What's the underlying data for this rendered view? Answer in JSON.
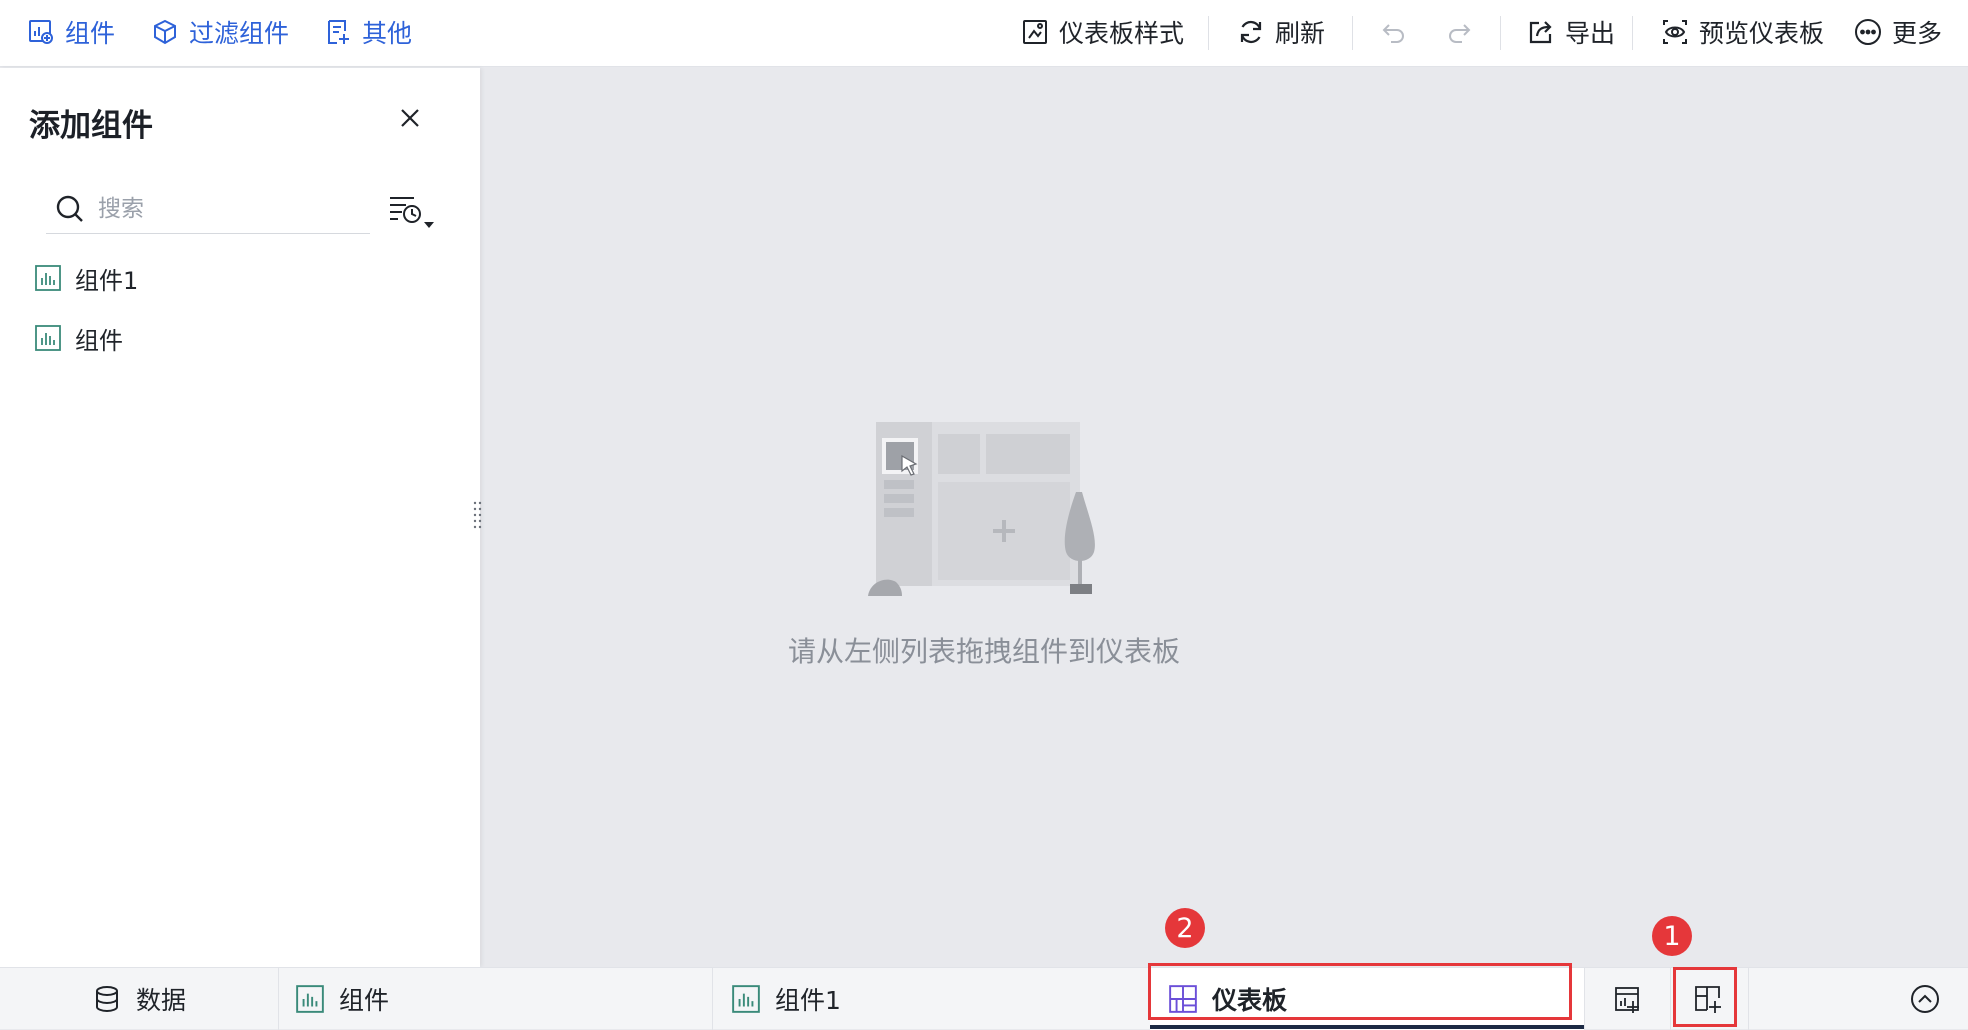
{
  "toolbar": {
    "left": [
      {
        "label": "组件",
        "icon": "add-chart-icon"
      },
      {
        "label": "过滤组件",
        "icon": "filter-cube-icon"
      },
      {
        "label": "其他",
        "icon": "edit-doc-icon"
      }
    ],
    "right": [
      {
        "label": "仪表板样式",
        "icon": "dashboard-style-icon"
      },
      {
        "label": "刷新",
        "icon": "refresh-icon"
      },
      {
        "label": "导出",
        "icon": "export-icon"
      },
      {
        "label": "预览仪表板",
        "icon": "preview-eye-icon"
      },
      {
        "label": "更多",
        "icon": "more-circle-icon"
      }
    ],
    "undo_icon": "undo-icon",
    "redo_icon": "redo-icon"
  },
  "panel": {
    "title": "添加组件",
    "search_placeholder": "搜索",
    "items": [
      {
        "label": "组件1",
        "icon": "bar-chart-icon"
      },
      {
        "label": "组件",
        "icon": "bar-chart-icon"
      }
    ]
  },
  "empty_state": {
    "message": "请从左侧列表拖拽组件到仪表板"
  },
  "bottom_tabs": {
    "data_label": "数据",
    "tabs": [
      {
        "label": "组件",
        "icon": "bar-chart-icon"
      },
      {
        "label": "组件1",
        "icon": "bar-chart-icon"
      },
      {
        "label": "仪表板",
        "icon": "dashboard-grid-icon",
        "active": true
      }
    ],
    "badges": [
      "2",
      "1"
    ]
  },
  "colors": {
    "accent_blue": "#2e62d9",
    "highlight_red": "#e5373a",
    "canvas_bg": "#e8e9ed",
    "dashboard_icon_purple": "#6b4fd8"
  }
}
